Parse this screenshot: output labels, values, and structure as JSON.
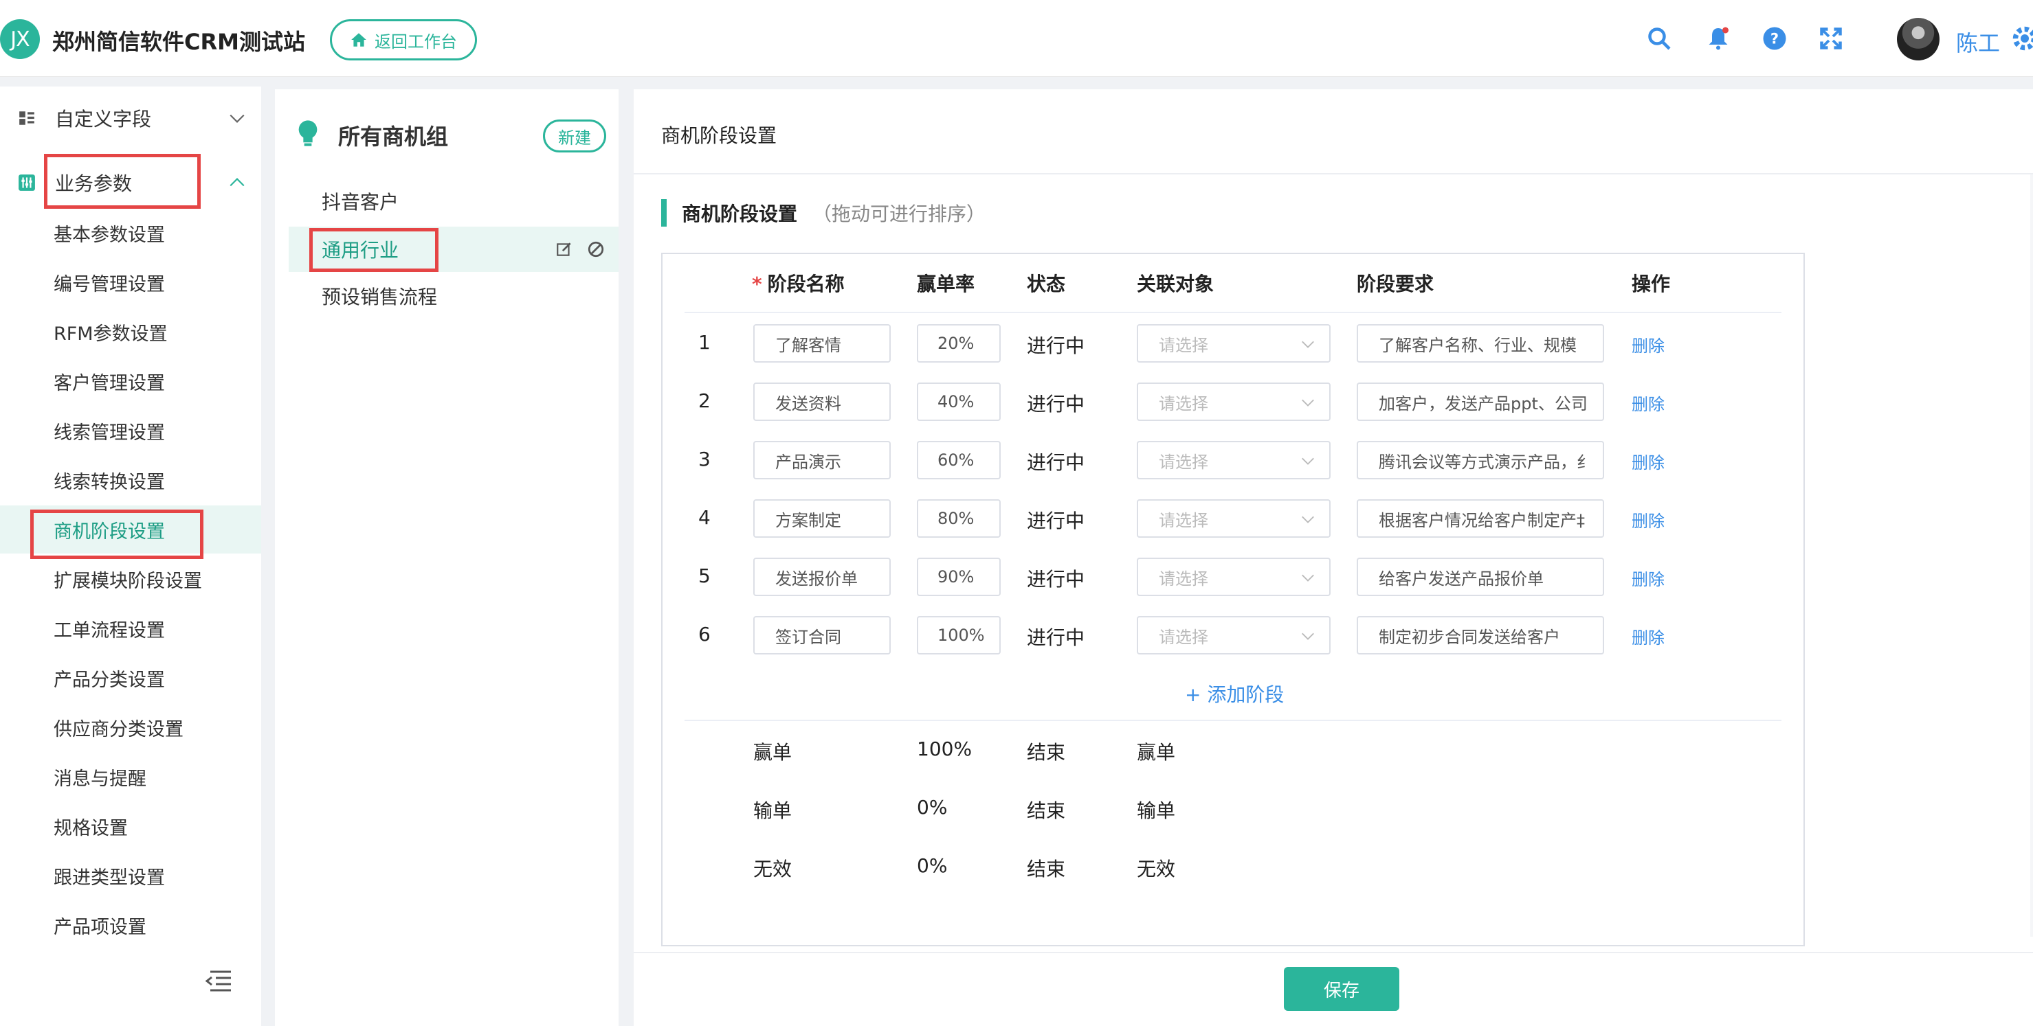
{
  "header": {
    "logo_text": "JX",
    "app_title": "郑州简信软件CRM测试站",
    "back_button": "返回工作台",
    "user_name": "陈工",
    "accent_color": "#2bb59b"
  },
  "sidebar": {
    "groups": [
      {
        "label": "自定义字段",
        "icon": "grid-list-icon",
        "expanded": false
      },
      {
        "label": "业务参数",
        "icon": "sliders-icon",
        "expanded": true
      }
    ],
    "items": [
      {
        "label": "基本参数设置"
      },
      {
        "label": "编号管理设置"
      },
      {
        "label": "RFM参数设置"
      },
      {
        "label": "客户管理设置"
      },
      {
        "label": "线索管理设置"
      },
      {
        "label": "线索转换设置"
      },
      {
        "label": "商机阶段设置",
        "active": true
      },
      {
        "label": "扩展模块阶段设置"
      },
      {
        "label": "工单流程设置"
      },
      {
        "label": "产品分类设置"
      },
      {
        "label": "供应商分类设置"
      },
      {
        "label": "消息与提醒"
      },
      {
        "label": "规格设置"
      },
      {
        "label": "跟进类型设置"
      },
      {
        "label": "产品项设置"
      }
    ]
  },
  "groups_panel": {
    "title": "所有商机组",
    "new_button": "新建",
    "items": [
      {
        "label": "抖音客户"
      },
      {
        "label": "通用行业",
        "active": true
      },
      {
        "label": "预设销售流程"
      }
    ]
  },
  "stage_panel": {
    "title": "商机阶段设置",
    "section_title": "商机阶段设置",
    "section_hint": "（拖动可进行排序）",
    "columns": {
      "name": "阶段名称",
      "rate": "赢单率",
      "status": "状态",
      "object": "关联对象",
      "requirement": "阶段要求",
      "action": "操作"
    },
    "select_placeholder": "请选择",
    "delete_label": "删除",
    "rows": [
      {
        "index": "1",
        "name": "了解客情",
        "rate": "20%",
        "status": "进行中",
        "requirement": "了解客户名称、行业、规模"
      },
      {
        "index": "2",
        "name": "发送资料",
        "rate": "40%",
        "status": "进行中",
        "requirement": "加客户，发送产品ppt、公司"
      },
      {
        "index": "3",
        "name": "产品演示",
        "rate": "60%",
        "status": "进行中",
        "requirement": "腾讯会议等方式演示产品，纟"
      },
      {
        "index": "4",
        "name": "方案制定",
        "rate": "80%",
        "status": "进行中",
        "requirement": "根据客户情况给客户制定产‡"
      },
      {
        "index": "5",
        "name": "发送报价单",
        "rate": "90%",
        "status": "进行中",
        "requirement": "给客户发送产品报价单"
      },
      {
        "index": "6",
        "name": "签订合同",
        "rate": "100%",
        "status": "进行中",
        "requirement": "制定初步合同发送给客户"
      }
    ],
    "add_stage": "+ 添加阶段",
    "final_rows": [
      {
        "name": "赢单",
        "rate": "100%",
        "status": "结束",
        "object": "赢单"
      },
      {
        "name": "输单",
        "rate": "0%",
        "status": "结束",
        "object": "输单"
      },
      {
        "name": "无效",
        "rate": "0%",
        "status": "结束",
        "object": "无效"
      }
    ],
    "save_button": "保存"
  }
}
